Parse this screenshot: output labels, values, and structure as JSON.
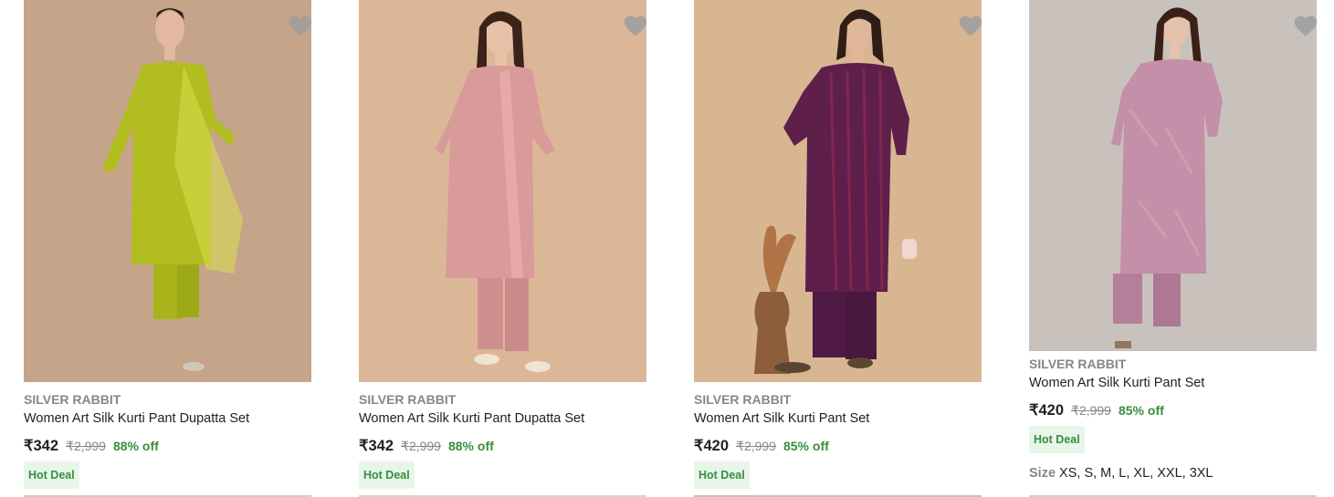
{
  "products": [
    {
      "brand": "SILVER RABBIT",
      "title": "Women Art Silk Kurti Pant Dupatta Set",
      "price": "₹342",
      "mrp": "₹2,999",
      "discount": "88% off",
      "badge": "Hot Deal",
      "bg": "#c5a489",
      "outfit": "#b2bd1f",
      "dupatta": true
    },
    {
      "brand": "SILVER RABBIT",
      "title": "Women Art Silk Kurti Pant Dupatta Set",
      "price": "₹342",
      "mrp": "₹2,999",
      "discount": "88% off",
      "badge": "Hot Deal",
      "bg": "#dcb797",
      "outfit": "#d99a9a",
      "dupatta": true
    },
    {
      "brand": "SILVER RABBIT",
      "title": "Women Art Silk Kurti Pant Set",
      "price": "₹420",
      "mrp": "₹2,999",
      "discount": "85% off",
      "badge": "Hot Deal",
      "bg": "#d9b692",
      "outfit": "#5e1f4b",
      "dupatta": false
    },
    {
      "brand": "SILVER RABBIT",
      "title": "Women Art Silk Kurti Pant Set",
      "price": "₹420",
      "mrp": "₹2,999",
      "discount": "85% off",
      "badge": "Hot Deal",
      "size_label": "Size",
      "sizes": "XS, S, M, L, XL, XXL, 3XL",
      "bg": "#c9c1bc",
      "outfit": "#c48fa8",
      "dupatta": false
    }
  ]
}
